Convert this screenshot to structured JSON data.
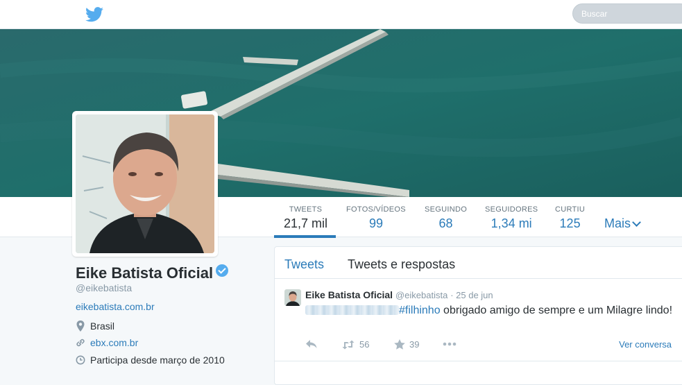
{
  "header": {
    "logo_icon": "twitter-bird-icon",
    "search_placeholder": "Buscar"
  },
  "profile_nav": {
    "stats": [
      {
        "label": "TWEETS",
        "value": "21,7 mil"
      },
      {
        "label": "FOTOS/VÍDEOS",
        "value": "99"
      },
      {
        "label": "SEGUINDO",
        "value": "68"
      },
      {
        "label": "SEGUIDORES",
        "value": "1,34 mi"
      },
      {
        "label": "CURTIU",
        "value": "125"
      }
    ],
    "more_label": "Mais"
  },
  "profile": {
    "name": "Eike Batista Oficial",
    "handle": "@eikebatista",
    "bio_url": "eikebatista.com.br",
    "location": "Brasil",
    "website": "ebx.com.br",
    "joined": "Participa desde março de 2010"
  },
  "timeline": {
    "tabs": [
      "Tweets",
      "Tweets e respostas"
    ],
    "tweet": {
      "author": "Eike Batista Oficial",
      "handle": "@eikebatista",
      "date": "· 25 de jun",
      "hashtag": "#filhinho",
      "text": " obrigado amigo de sempre e um Milagre lindo!",
      "retweets": "56",
      "likes": "39",
      "view_conversation": "Ver conversa"
    }
  },
  "colors": {
    "accent": "#2b7bb9",
    "verified": "#55acee"
  }
}
